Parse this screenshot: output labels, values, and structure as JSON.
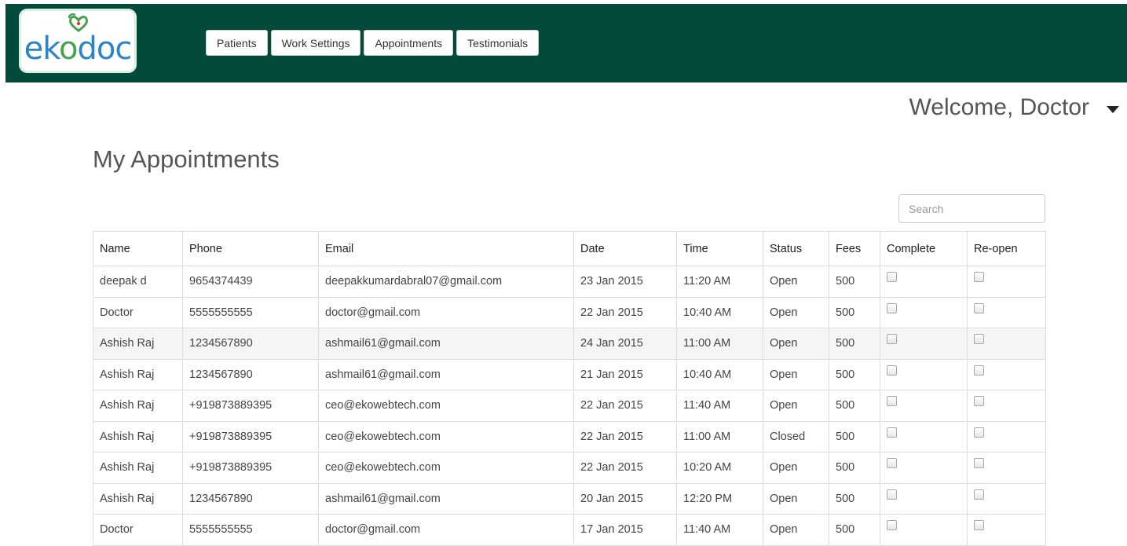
{
  "header": {
    "logo": {
      "part1": "ek",
      "part2": "o",
      "part3": "doc"
    },
    "nav": [
      "Patients",
      "Work Settings",
      "Appointments",
      "Testimonials"
    ]
  },
  "user_menu": {
    "welcome": "Welcome, Doctor"
  },
  "page": {
    "title": "My Appointments"
  },
  "search": {
    "placeholder": "Search"
  },
  "table": {
    "columns": [
      "Name",
      "Phone",
      "Email",
      "Date",
      "Time",
      "Status",
      "Fees",
      "Complete",
      "Re-open"
    ],
    "rows": [
      {
        "name": "deepak d",
        "phone": "9654374439",
        "email": "deepakkumardabral07@gmail.com",
        "date": "23 Jan 2015",
        "time": "11:20 AM",
        "status": "Open",
        "fees": "500"
      },
      {
        "name": "Doctor",
        "phone": "5555555555",
        "email": "doctor@gmail.com",
        "date": "22 Jan 2015",
        "time": "10:40 AM",
        "status": "Open",
        "fees": "500"
      },
      {
        "name": "Ashish Raj",
        "phone": "1234567890",
        "email": "ashmail61@gmail.com",
        "date": "24 Jan 2015",
        "time": "11:00 AM",
        "status": "Open",
        "fees": "500"
      },
      {
        "name": "Ashish Raj",
        "phone": "1234567890",
        "email": "ashmail61@gmail.com",
        "date": "21 Jan 2015",
        "time": "10:40 AM",
        "status": "Open",
        "fees": "500"
      },
      {
        "name": "Ashish Raj",
        "phone": "+919873889395",
        "email": "ceo@ekowebtech.com",
        "date": "22 Jan 2015",
        "time": "11:40 AM",
        "status": "Open",
        "fees": "500"
      },
      {
        "name": "Ashish Raj",
        "phone": "+919873889395",
        "email": "ceo@ekowebtech.com",
        "date": "22 Jan 2015",
        "time": "11:00 AM",
        "status": "Closed",
        "fees": "500"
      },
      {
        "name": "Ashish Raj",
        "phone": "+919873889395",
        "email": "ceo@ekowebtech.com",
        "date": "22 Jan 2015",
        "time": "10:20 AM",
        "status": "Open",
        "fees": "500"
      },
      {
        "name": "Ashish Raj",
        "phone": "1234567890",
        "email": "ashmail61@gmail.com",
        "date": "20 Jan 2015",
        "time": "12:20 PM",
        "status": "Open",
        "fees": "500"
      },
      {
        "name": "Doctor",
        "phone": "5555555555",
        "email": "doctor@gmail.com",
        "date": "17 Jan 2015",
        "time": "11:40 AM",
        "status": "Open",
        "fees": "500"
      }
    ]
  },
  "colors": {
    "header_bg": "#024b3a",
    "logo_blue": "#2b84c6",
    "logo_green": "#46a24d",
    "row_highlight": "#f5f5f5"
  },
  "icons": {
    "logo_mark": "leaf-heart-icon",
    "user_menu": "caret-down-icon"
  }
}
